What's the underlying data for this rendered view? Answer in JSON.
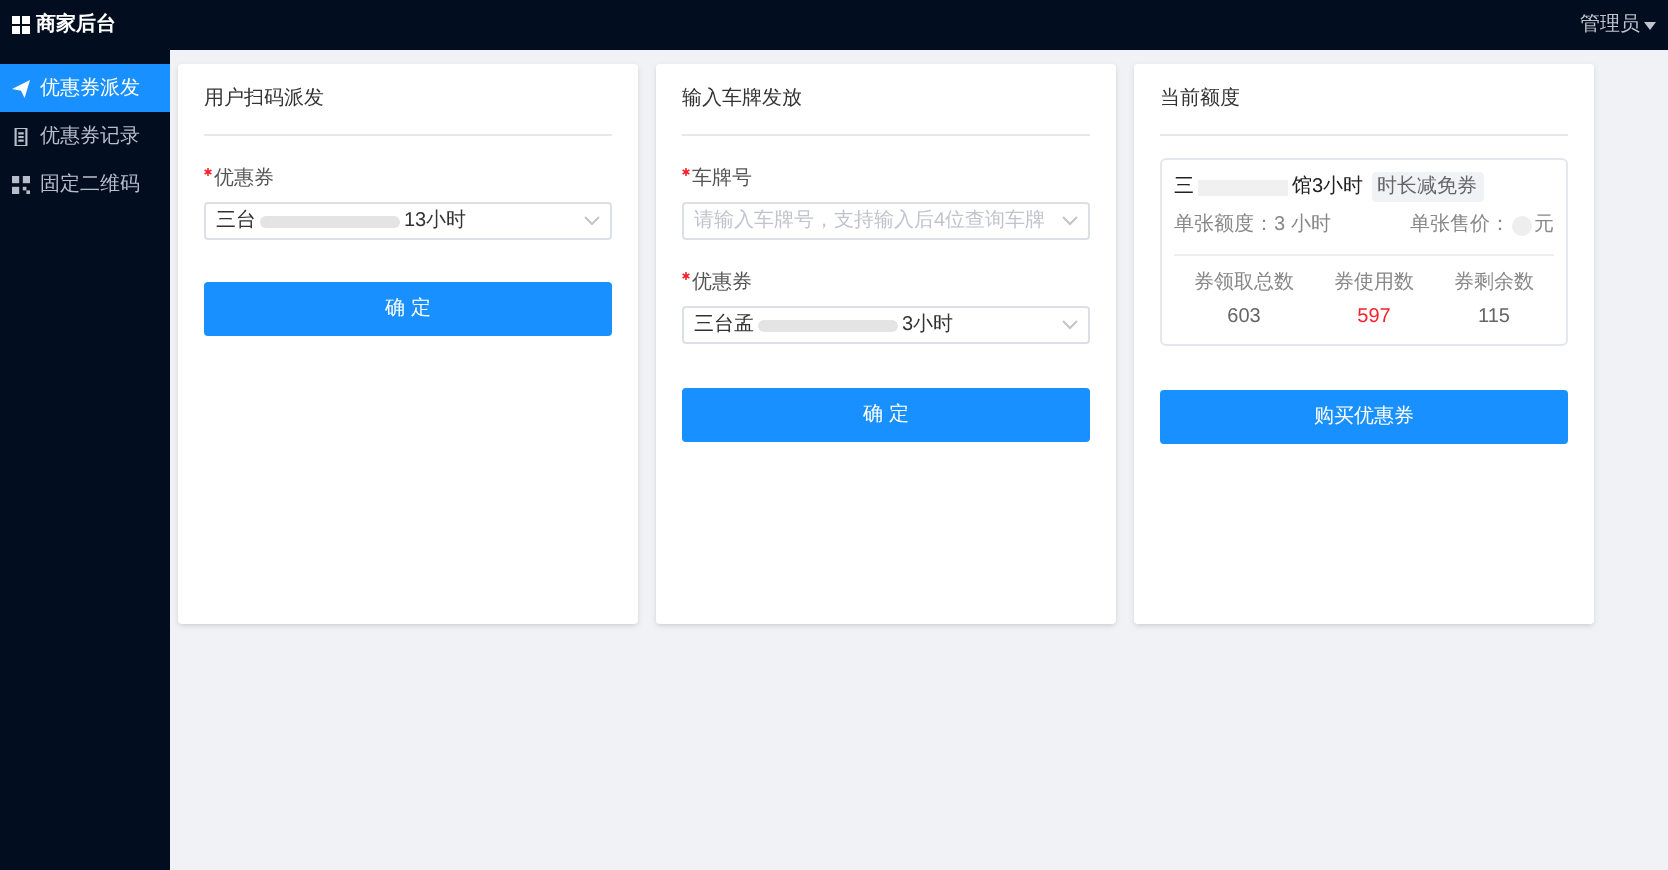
{
  "app_title": "商家后台",
  "user_menu": {
    "label": "管理员"
  },
  "sidebar": {
    "items": [
      {
        "label": "优惠券派发",
        "selected": true
      },
      {
        "label": "优惠券记录",
        "selected": false
      },
      {
        "label": "固定二维码",
        "selected": false
      }
    ]
  },
  "scan_card": {
    "title": "用户扫码派发",
    "coupon_label": "优惠券",
    "required": true,
    "coupon_value_start": "三台",
    "coupon_value_end": "13小时",
    "button": "确 定"
  },
  "plate_card": {
    "title": "输入车牌发放",
    "plate_label": "车牌号",
    "plate_required": true,
    "coupon_required": true,
    "plate_placeholder": "请输入车牌号，支持输入后4位查询车牌",
    "coupon_label": "优惠券",
    "coupon_value_start": "三台孟",
    "coupon_value_end": "3小时",
    "button": "确 定"
  },
  "quota_card": {
    "title": "当前额度",
    "coupon_name_start": "三",
    "coupon_name_end": "馆3小时",
    "tag": "时长减免券",
    "amount": "单张额度：3 小时",
    "price_label": "单张售价：",
    "price_unit": "元",
    "stats": [
      {
        "label": "券领取总数",
        "value": "603",
        "highlight": false
      },
      {
        "label": "券使用数",
        "value": "597",
        "highlight": true
      },
      {
        "label": "券剩余数",
        "value": "115",
        "highlight": false
      }
    ],
    "button": "购买优惠券"
  }
}
